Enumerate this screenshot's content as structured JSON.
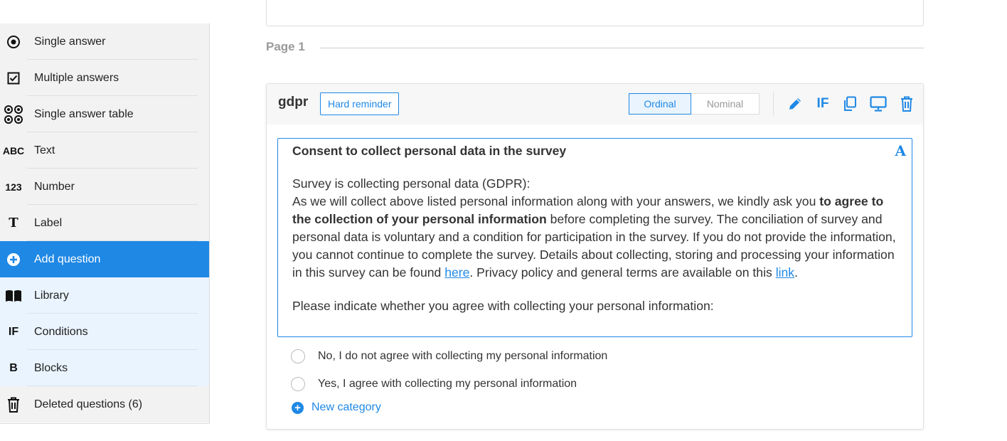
{
  "sidebar": {
    "items": [
      {
        "label": "Single answer",
        "icon": "radio-dot-icon"
      },
      {
        "label": "Multiple answers",
        "icon": "checkbox-icon"
      },
      {
        "label": "Single answer table",
        "icon": "radio-grid-icon"
      },
      {
        "label": "Text",
        "icon_text": "ABC"
      },
      {
        "label": "Number",
        "icon_text": "123"
      },
      {
        "label": "Label",
        "icon_text": "T"
      },
      {
        "label": "Add question",
        "icon": "plus-circle-icon"
      },
      {
        "label": "Library",
        "icon": "book-icon"
      },
      {
        "label": "Conditions",
        "icon_text": "IF"
      },
      {
        "label": "Blocks",
        "icon_text": "B"
      },
      {
        "label": "Deleted questions (6)",
        "icon": "trash-icon"
      }
    ]
  },
  "page": {
    "label": "Page 1"
  },
  "question": {
    "code": "gdpr",
    "hard_reminder": "Hard reminder",
    "scale": {
      "ordinal": "Ordinal",
      "nominal": "Nominal",
      "selected": "Ordinal"
    },
    "tools": {
      "if_label": "IF"
    },
    "editor_icon": "A",
    "text": {
      "title": "Consent to collect personal data in the survey",
      "line1": "Survey is collecting personal data (GDPR):",
      "p_start": "As we will collect above listed personal information along with your answers, we kindly ask you ",
      "p_bold": "to agree to the collection of your personal information",
      "p_mid": " before completing the survey. The conciliation of survey and personal data is voluntary and a condition for participation in the survey. If you do not provide the information, you cannot continue to complete the survey. Details about collecting, storing and processing your information in this survey can be found ",
      "link1": "here",
      "p_mid2": ". Privacy policy and general terms are available on this ",
      "link2": "link",
      "p_end": ".",
      "last": "Please indicate whether you agree with collecting your personal information:"
    },
    "options": [
      "No, I do not agree with collecting my personal information",
      "Yes, I agree with collecting my personal information"
    ],
    "new_category": "New category"
  },
  "colors": {
    "accent": "#1f88e5",
    "sidebar_bg": "#f2f2f2",
    "light_bg": "#eaf4fe"
  }
}
